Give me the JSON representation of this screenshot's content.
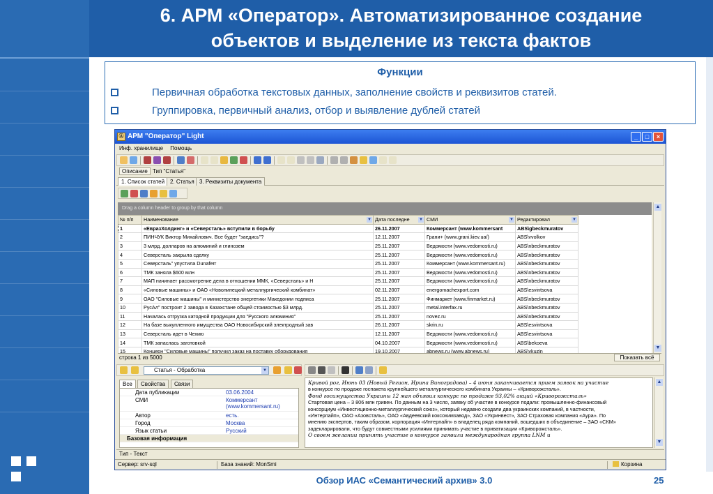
{
  "slide": {
    "title_line1": "6. АРМ «Оператор». Автоматизированное создание",
    "title_line2": "объектов и выделение из текста фактов",
    "footer": "Обзор ИАС «Семантический архив» 3.0",
    "page_number": "25",
    "accent_color": "#1f5ea8"
  },
  "functions": {
    "heading": "Функции",
    "items": [
      "Первичная обработка текстовых данных, заполнение свойств и реквизитов статей.",
      "Группировка, первичный анализ, отбор и выявление дублей статей"
    ]
  },
  "window": {
    "title": "АРМ \"Оператор\" Light",
    "menu": [
      "Инф. хранилище",
      "Помощь"
    ],
    "description_label": "Описание",
    "description_value": "Тип \"Статья\"",
    "tabs": [
      "1. Список статей",
      "2. Статья",
      "3. Реквизиты документа"
    ],
    "group_hint": "Drag a column header to group by that column",
    "columns": [
      "№ п/п",
      "Наименование",
      "Дата последне",
      "СМИ",
      "Редактировал"
    ],
    "rows": [
      [
        "1",
        "«ЕвразХолдинг» и «Северсталь» вступили в борьбу",
        "26.11.2007",
        "Коммерсант (www.kommersant",
        "ABS\\gbeckmuratov"
      ],
      [
        "2",
        "ПИНЧУК Виктор Михайлович. Все будет \"заедись\"?",
        "12.11.2007",
        "Грани+ (www.grani.kiev.ua/)",
        "ABS\\vvolkov"
      ],
      [
        "3",
        "3 млрд. долларов на алюминий и глинозем",
        "25.11.2007",
        "Ведомости (www.vedomosti.ru)",
        "ABS\\nbeckmuratov"
      ],
      [
        "4",
        "Северсталь закрыла сделку",
        "25.11.2007",
        "Ведомости (www.vedomosti.ru)",
        "ABS\\nbeckmuratov"
      ],
      [
        "5",
        "Северсталь\" упустила Dunaferr",
        "25.11.2007",
        "Коммерсант (www.kommersant.ru)",
        "ABS\\nbeckmuratov"
      ],
      [
        "6",
        "ТМК заняла $600 млн",
        "25.11.2007",
        "Ведомости (www.vedomosti.ru)",
        "ABS\\nbeckmuratov"
      ],
      [
        "7",
        "МАП начинает рассмотрение дела в отношении ММК, «Северсталь» и Н",
        "25.11.2007",
        "Ведомости (www.vedomosti.ru)",
        "ABS\\nbeckmuratov"
      ],
      [
        "8",
        "«Силовые машины» и ОАО «Новолипецкий металлургический комбинат»",
        "02.11.2007",
        "energomachexport.com",
        "ABS\\esvintsova"
      ],
      [
        "9",
        "ОАО \"Силовые машины\" и министерство энергетики Македонии подписа",
        "25.11.2007",
        "Финмаркет (www.finmarket.ru)",
        "ABS\\nbeckmuratov"
      ],
      [
        "10",
        "РусАл\" построит 2 завода в Казахстане общей стоимостью $3 млрд.",
        "25.11.2007",
        "metal.interfax.ru",
        "ABS\\nbeckmuratov"
      ],
      [
        "11",
        "Началась отгрузка катодной продукции для \"Русского алюминия\"",
        "25.11.2007",
        "novez.ru",
        "ABS\\nbeckmuratov"
      ],
      [
        "12",
        "На базе выкупленного имущества ОАО Новосибирский электродный зав",
        "26.11.2007",
        "skrin.ru",
        "ABS\\esvintsova"
      ],
      [
        "13",
        "Северсталь  идет в Чехию",
        "12.11.2007",
        "Ведомости (www.vedomosti.ru)",
        "ABS\\esvintsova"
      ],
      [
        "14",
        "ТМК запаслась заготовкой",
        "04.10.2007",
        "Ведомости (www.vedomosti.ru)",
        "ABS\\bekoeva"
      ],
      [
        "15",
        "Концерн \"Силовые машины\" получил заказ на поставку оборудования",
        "19.10.2007",
        "abnews.ru (www.abnews.ru)",
        "ABS\\vkuzin"
      ]
    ],
    "row_count": "строка 1 из 5000",
    "show_all": "Показать всё",
    "object_combo": "Статья - Обработка",
    "lower_tabs": [
      "Все",
      "Свойства",
      "Связи"
    ],
    "properties": [
      {
        "key": "Дата публикации",
        "value": "03.06.2004"
      },
      {
        "key": "СМИ",
        "value": "Коммерсант (www.kommersant.ru)"
      },
      {
        "key": "Автор",
        "value": "есть."
      },
      {
        "key": "Город",
        "value": "Москва"
      },
      {
        "key": "Язык статьи",
        "value": "Русский"
      }
    ],
    "property_group": "Базовая информация",
    "text_lines": [
      "Кривой рог, Июнь 03 (Новый Регион, Ирина Виноградова) – 4 июня заканчивается прием заявок на участие",
      "в конкурсе по продаже госпакета крупнейшего металлургического комбината Украины – «Криворожсталь».",
      "Фонд госимущества Украины 12 мая объявил конкурс по продаже 93,02% акций «Криворожсталь»",
      "Стартовая цена – 3 806 млн гривен. По данным на 3 число, заявку об участие в конкурсе подали: промышленно-финансовый",
      "консорциум «Инвестиционно-металлургический союз», который недавно создали два украинских компаний, в частности,",
      "«Интерпайп», ОАО «Азовсталь», ОАО «Авдеевский коксохимзавод», ЗАО «Укринвест», ЗАО Страховая компания «Аура». По",
      "мнению экспертов, таким образом, корпорация «Интерпайп» в владелец ряда компаний, вошедших в объединение – ЗАО «СКМ»",
      "задекларировали, что будут совместными усилиями принимать участие в приватизации «Криворожсталь».",
      "О своем желании принять участие в конкурсе заявили международная группа LNM u"
    ],
    "type_label": "Тип - Текст",
    "status_server": "Сервер: srv-sql",
    "status_db": "База знаний: MonSmi",
    "status_basket": "Корзина"
  }
}
